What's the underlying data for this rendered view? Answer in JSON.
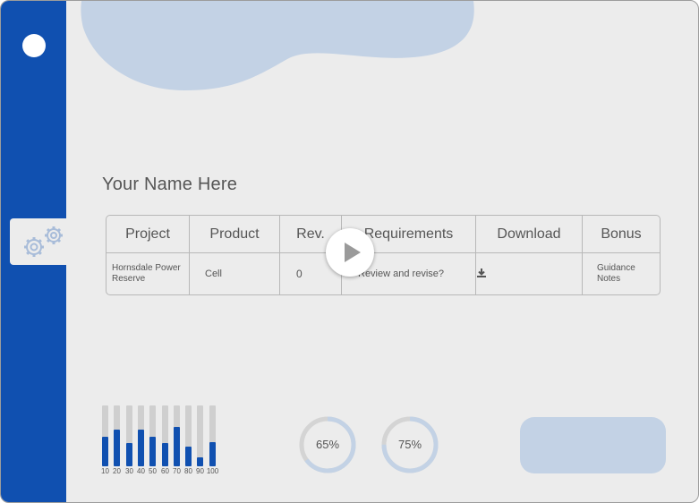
{
  "user": {
    "name": "Your Name Here"
  },
  "table": {
    "headers": [
      "Project",
      "Product",
      "Rev.",
      "Requirements",
      "Download",
      "Bonus"
    ],
    "row": {
      "project": "Hornsdale Power Reserve",
      "product": "Cell",
      "rev": "0",
      "requirements": "Review and revise?",
      "download_icon": "download-icon",
      "bonus": "Guidance Notes"
    }
  },
  "bar_chart": {
    "labels": [
      "10",
      "20",
      "30",
      "40",
      "50",
      "60",
      "70",
      "80",
      "90",
      "100"
    ],
    "fill_fractions": [
      0.48,
      0.61,
      0.38,
      0.61,
      0.49,
      0.38,
      0.64,
      0.32,
      0.15,
      0.39
    ]
  },
  "progress_rings": [
    {
      "label": "65%",
      "value": 0.65
    },
    {
      "label": "75%",
      "value": 0.75
    }
  ],
  "icons": {
    "sidebar_tab": "gears-icon",
    "video": "play-icon"
  },
  "colors": {
    "sidebar": "#1050b0",
    "accent_light": "#c3d2e5",
    "background": "#ececec",
    "bar_fill": "#1050b0",
    "bar_track": "#cfcfcf"
  }
}
